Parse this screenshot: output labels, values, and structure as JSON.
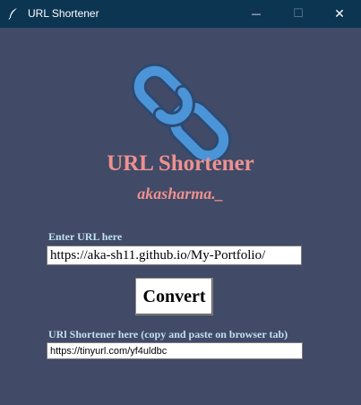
{
  "window": {
    "title": "URL Shortener",
    "icon": "feather-icon",
    "controls": {
      "minimize": "—",
      "maximize": "☐",
      "close": "✕"
    }
  },
  "app": {
    "logo_icon": "chain-link-icon",
    "title": "URL Shortener",
    "author": "akasharma._"
  },
  "form": {
    "url_label": "Enter URL here",
    "url_value": "https://aka-sh11.github.io/My-Portfolio/",
    "convert_label": "Convert",
    "result_label": "URl Shortener here (copy and paste on browser tab)",
    "result_value": "https://tinyurl.com/yf4uldbc"
  },
  "colors": {
    "background": "#414a66",
    "titlebar": "#0c3552",
    "accent": "#ee9190",
    "label": "#bfe0f0",
    "logo_fill": "#4b94d7",
    "logo_stroke": "#2c4a72"
  }
}
